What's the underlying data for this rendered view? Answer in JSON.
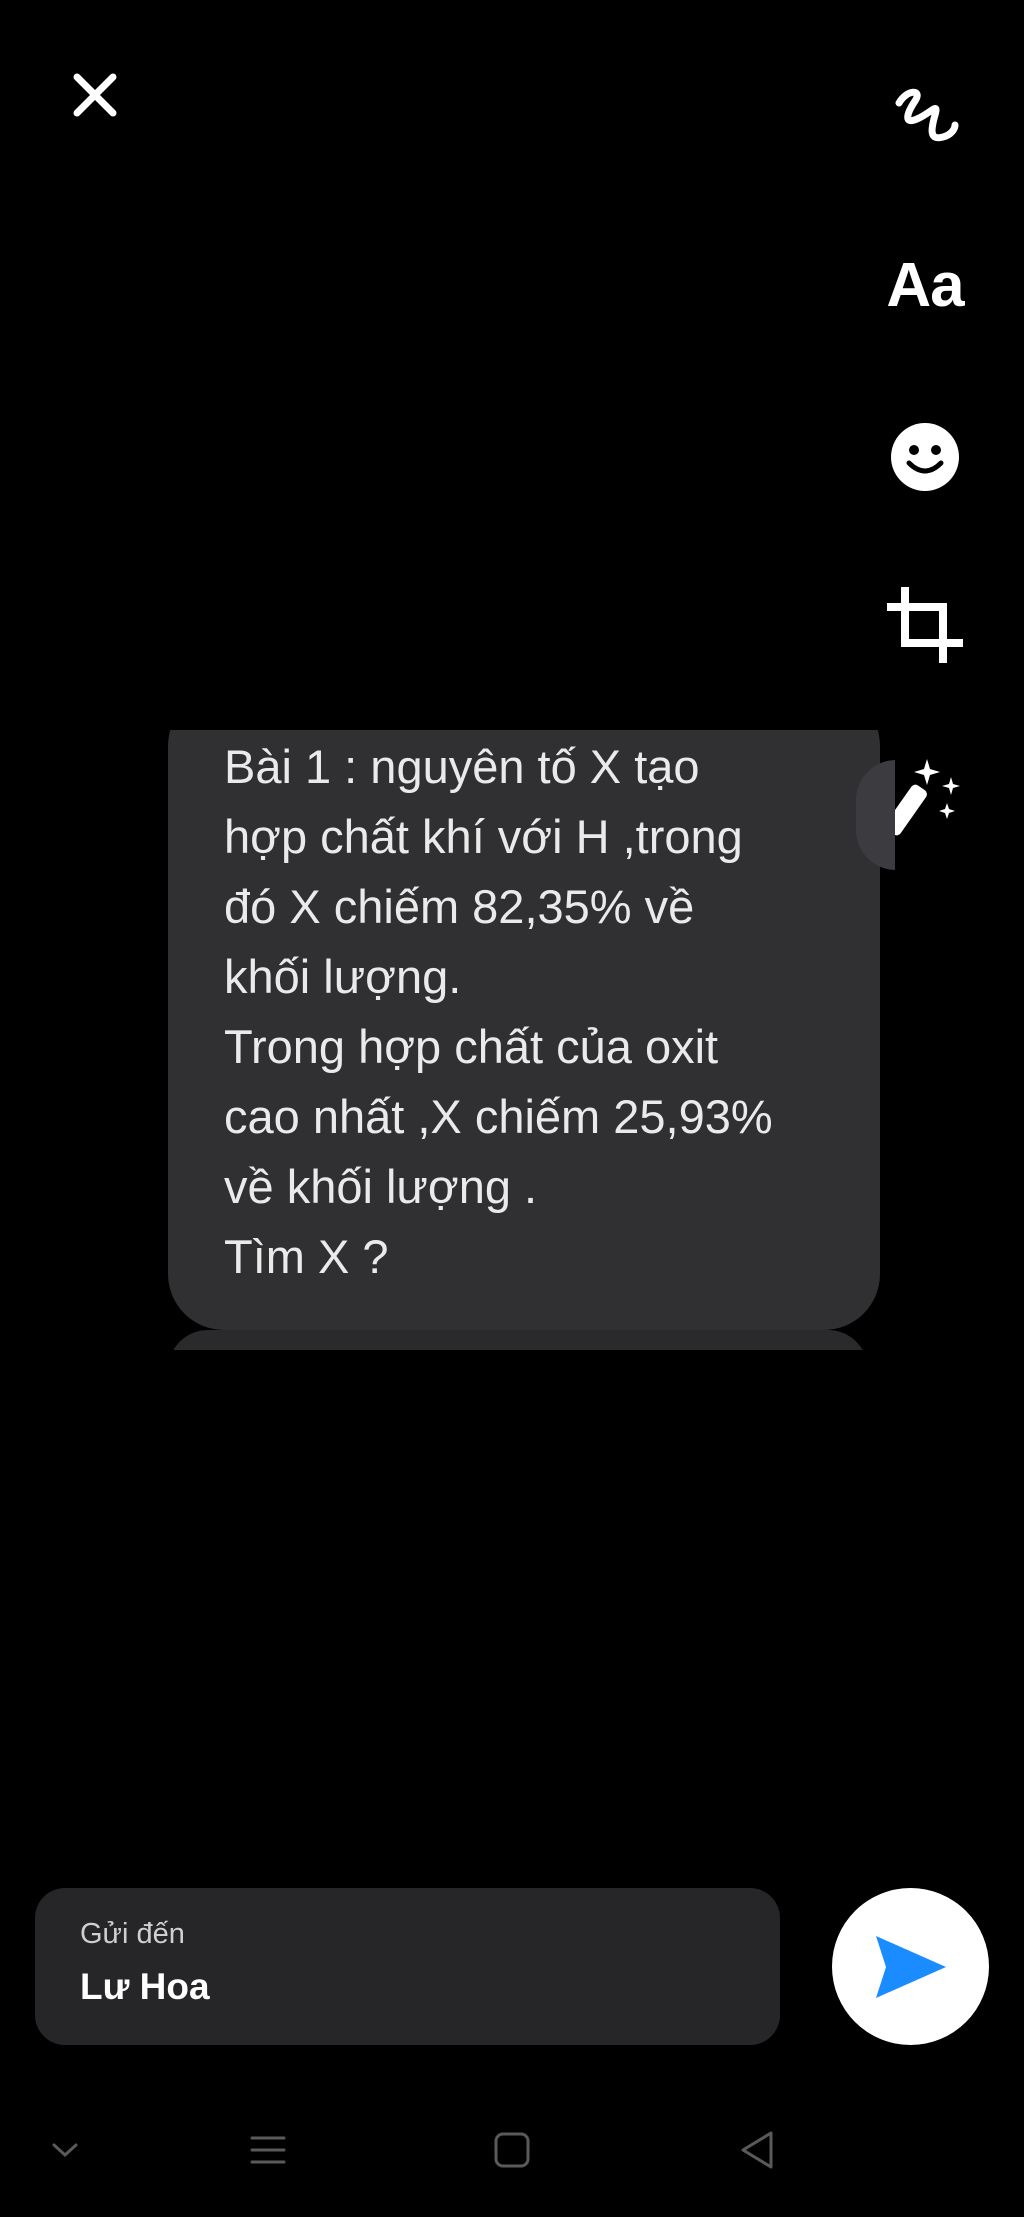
{
  "toolbar": {
    "text_tool_label": "Aa"
  },
  "message": {
    "text": "Bài 1 : nguyên tố X tạo\nhợp chất khí với H ,trong\nđó X chiếm 82,35% về\nkhối lượng.\nTrong hợp chất của oxit\ncao nhất ,X chiếm 25,93%\nvề khối lượng .\nTìm X ?"
  },
  "send": {
    "label": "Gửi đến",
    "recipient": "Lư Hoa"
  },
  "icons": {
    "close": "close-icon",
    "draw": "scribble-icon",
    "sticker": "smiley-icon",
    "crop": "crop-icon",
    "effects": "magic-wand-icon",
    "send": "send-arrow-icon"
  },
  "colors": {
    "background": "#000000",
    "bubble": "#303033",
    "send_box": "#262628",
    "send_accent": "#1a8cff"
  }
}
